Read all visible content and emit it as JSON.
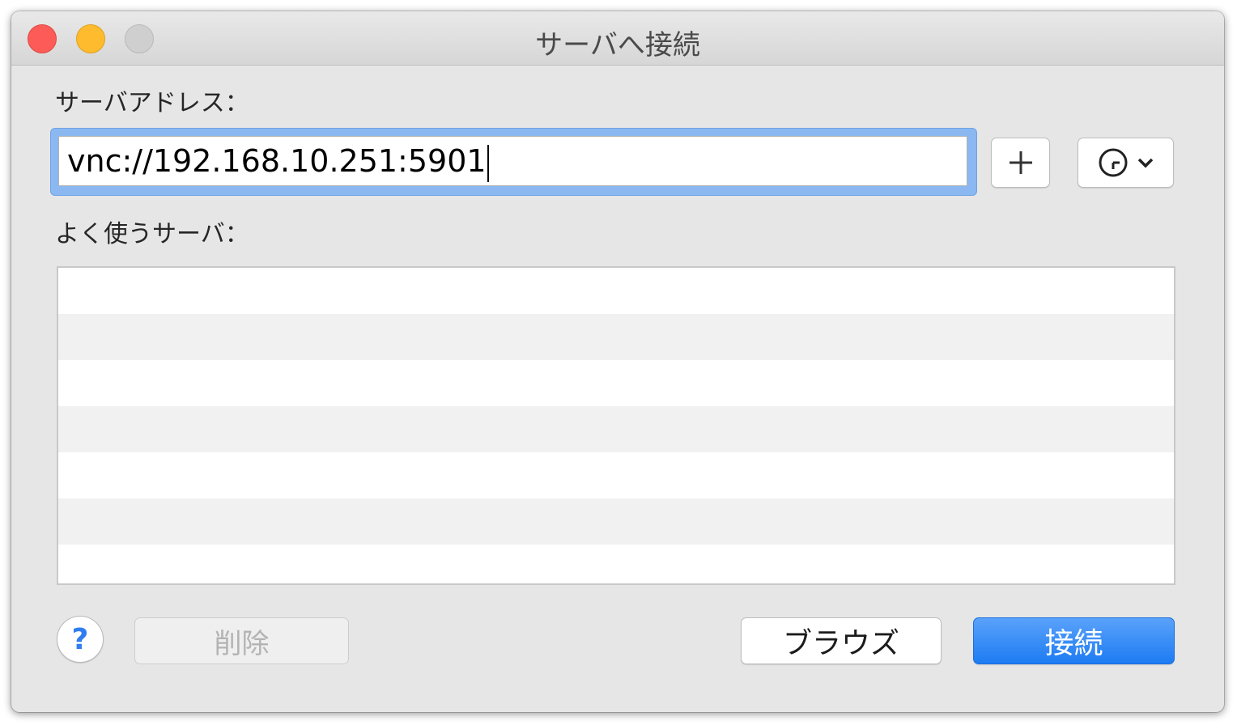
{
  "window": {
    "title": "サーバへ接続"
  },
  "server_address": {
    "label": "サーバアドレス：",
    "value": "vnc://192.168.10.251:5901"
  },
  "toolbar": {
    "add_icon": "plus-icon",
    "recent_icon": "clock-icon",
    "recent_dropdown_icon": "chevron-down-icon"
  },
  "favorites": {
    "label": "よく使うサーバ：",
    "items": []
  },
  "buttons": {
    "help_label": "?",
    "delete_label": "削除",
    "browse_label": "ブラウズ",
    "connect_label": "接続"
  },
  "colors": {
    "accent": "#1d7bf2",
    "focus_ring": "#8bb8f0",
    "close": "#fc5b57",
    "minimize": "#fdbb2d",
    "zoom_disabled": "#cfcfcf"
  }
}
